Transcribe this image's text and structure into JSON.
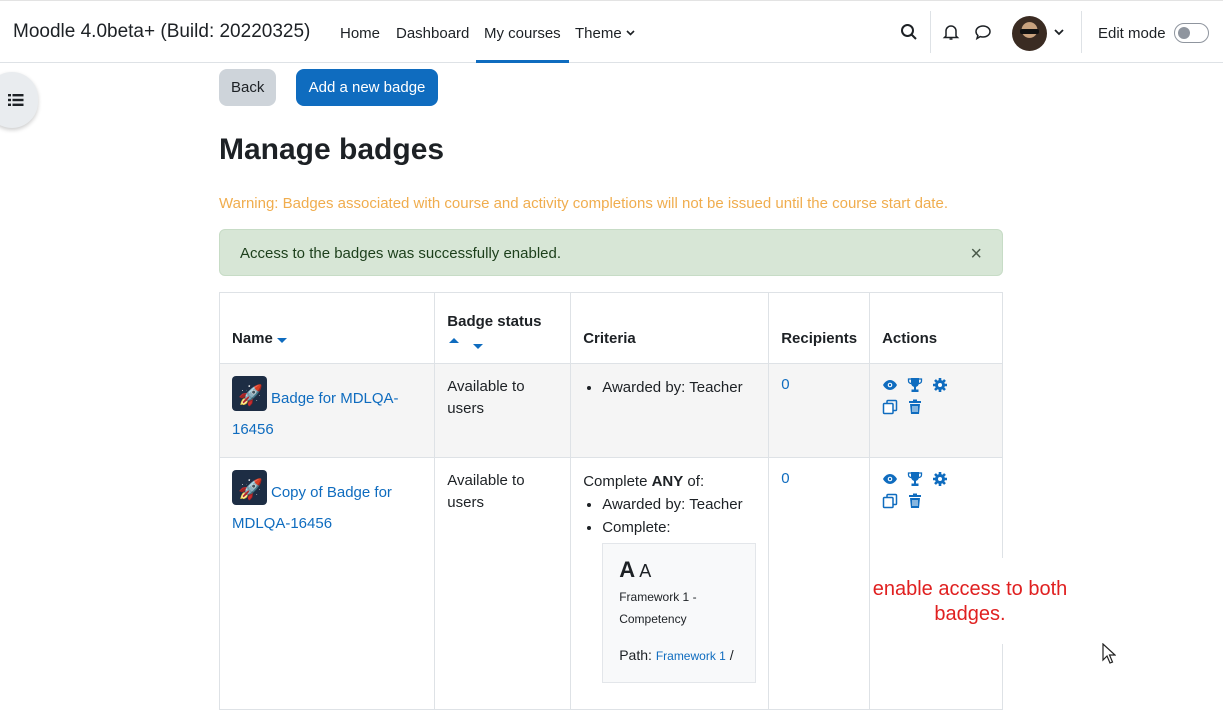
{
  "navbar": {
    "brand": "Moodle 4.0beta+ (Build: 20220325)",
    "links": [
      {
        "label": "Home"
      },
      {
        "label": "Dashboard"
      },
      {
        "label": "My courses"
      },
      {
        "label": "Theme"
      }
    ],
    "edit_mode_label": "Edit mode",
    "accent": "#0f6cbf"
  },
  "toolbar": {
    "back_label": "Back",
    "add_label": "Add a new badge"
  },
  "page": {
    "title": "Manage badges",
    "warning": "Warning: Badges associated with course and activity completions will not be issued until the course start date.",
    "alert": "Access to the badges was successfully enabled.",
    "alert_close": "×"
  },
  "table": {
    "headers": {
      "name": "Name",
      "status": "Badge status",
      "criteria": "Criteria",
      "recipients": "Recipients",
      "actions": "Actions"
    },
    "rows": [
      {
        "name": "Badge for MDLQA-16456",
        "status": "Available to users",
        "criteria": [
          "Awarded by: Teacher"
        ],
        "recipients": "0"
      },
      {
        "name": "Copy of Badge for MDLQA-16456",
        "status": "Available to users",
        "criteria_intro_prefix": "Complete ",
        "criteria_intro_bold": "ANY",
        "criteria_intro_suffix": " of:",
        "criteria": [
          "Awarded by: Teacher",
          "Complete:"
        ],
        "competency": {
          "big": "A",
          "small": "A",
          "framework": "Framework 1 - Competency",
          "path_label": "Path: ",
          "path_link": "Framework 1",
          "path_sep": " /"
        },
        "recipients": "0"
      }
    ]
  },
  "annotation": {
    "text": "enable access to both badges.",
    "color": "#e02020"
  }
}
